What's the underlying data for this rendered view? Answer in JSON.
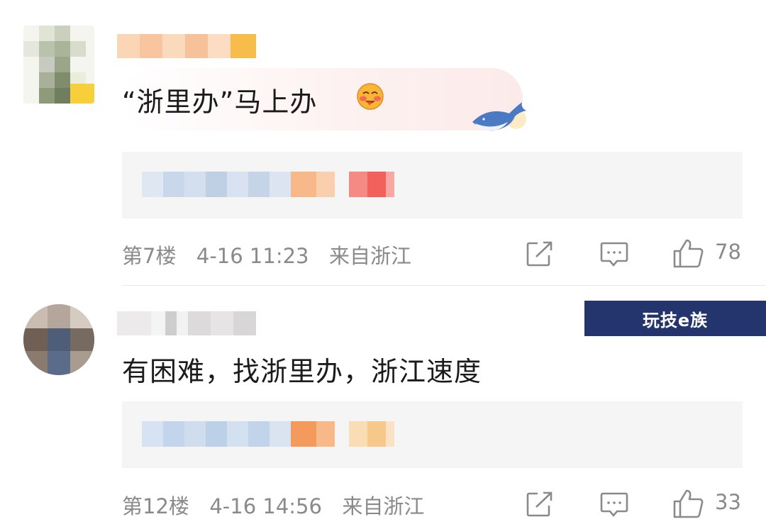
{
  "comments": [
    {
      "text": "“浙里办”马上办",
      "floor": "第7楼",
      "time": "4-16 11:23",
      "location": "来自浙江",
      "likes": "78"
    },
    {
      "text": "有困难，找浙里办，浙江速度",
      "floor": "第12楼",
      "time": "4-16 14:56",
      "location": "来自浙江",
      "likes": "33"
    }
  ],
  "icons": [
    "share-icon",
    "comment-icon",
    "thumbs-up-icon",
    "blush-emoji-icon",
    "whale-icon"
  ],
  "watermark": "玩技e族",
  "colors": {
    "text": "#1b1b1b",
    "meta": "#8a8a8a",
    "quote_bg": "#f5f5f5",
    "bubble": "#fbeae9",
    "watermark_bg": "#24356e"
  }
}
